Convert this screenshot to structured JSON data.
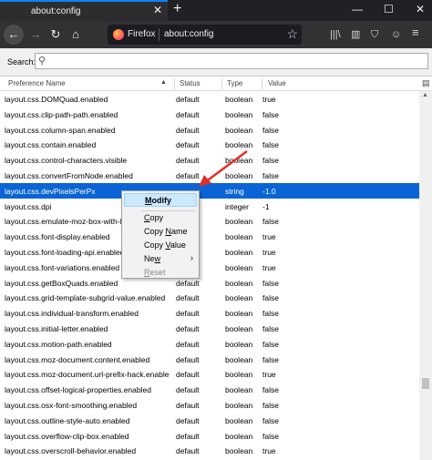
{
  "tab": {
    "title": "about:config",
    "close": "✕",
    "new_tab": "+"
  },
  "window_controls": {
    "minimize": "—",
    "maximize": "☐",
    "close": "✕"
  },
  "nav": {
    "back": "←",
    "forward": "→",
    "reload": "↻",
    "home": "⌂"
  },
  "urlbar": {
    "brand": "Firefox",
    "url": "about:config"
  },
  "toolbar": {
    "library": "|||\\",
    "sidebar": "▥",
    "shield": "⛉",
    "pocket": "☺",
    "menu": "≡"
  },
  "search": {
    "label": "Search:",
    "value": "",
    "glass": "⚲"
  },
  "columns": [
    "Preference Name",
    "Status",
    "Type",
    "Value"
  ],
  "rows": [
    {
      "name": "layout.css.DOMQuad.enabled",
      "status": "default",
      "type": "boolean",
      "value": "true"
    },
    {
      "name": "layout.css.clip-path-path.enabled",
      "status": "default",
      "type": "boolean",
      "value": "false"
    },
    {
      "name": "layout.css.column-span.enabled",
      "status": "default",
      "type": "boolean",
      "value": "false"
    },
    {
      "name": "layout.css.contain.enabled",
      "status": "default",
      "type": "boolean",
      "value": "false"
    },
    {
      "name": "layout.css.control-characters.visible",
      "status": "default",
      "type": "boolean",
      "value": "false"
    },
    {
      "name": "layout.css.convertFromNode.enabled",
      "status": "default",
      "type": "boolean",
      "value": "false"
    },
    {
      "name": "layout.css.devPixelsPerPx",
      "status": "",
      "type": "string",
      "value": "-1.0",
      "selected": true
    },
    {
      "name": "layout.css.dpi",
      "status": "",
      "type": "integer",
      "value": "-1"
    },
    {
      "name": "layout.css.emulate-moz-box-with-f",
      "status": "",
      "type": "boolean",
      "value": "false"
    },
    {
      "name": "layout.css.font-display.enabled",
      "status": "",
      "type": "boolean",
      "value": "true"
    },
    {
      "name": "layout.css.font-loading-api.enabled",
      "status": "",
      "type": "boolean",
      "value": "true"
    },
    {
      "name": "layout.css.font-variations.enabled",
      "status": "",
      "type": "boolean",
      "value": "true"
    },
    {
      "name": "layout.css.getBoxQuads.enabled",
      "status": "default",
      "type": "boolean",
      "value": "false"
    },
    {
      "name": "layout.css.grid-template-subgrid-value.enabled",
      "status": "default",
      "type": "boolean",
      "value": "false"
    },
    {
      "name": "layout.css.individual-transform.enabled",
      "status": "default",
      "type": "boolean",
      "value": "false"
    },
    {
      "name": "layout.css.initial-letter.enabled",
      "status": "default",
      "type": "boolean",
      "value": "false"
    },
    {
      "name": "layout.css.motion-path.enabled",
      "status": "default",
      "type": "boolean",
      "value": "false"
    },
    {
      "name": "layout.css.moz-document.content.enabled",
      "status": "default",
      "type": "boolean",
      "value": "false"
    },
    {
      "name": "layout.css.moz-document.url-prefix-hack.enabled",
      "status": "default",
      "type": "boolean",
      "value": "true"
    },
    {
      "name": "layout.css.offset-logical-properties.enabled",
      "status": "default",
      "type": "boolean",
      "value": "false"
    },
    {
      "name": "layout.css.osx-font-smoothing.enabled",
      "status": "default",
      "type": "boolean",
      "value": "false"
    },
    {
      "name": "layout.css.outline-style-auto.enabled",
      "status": "default",
      "type": "boolean",
      "value": "false"
    },
    {
      "name": "layout.css.overflow-clip-box.enabled",
      "status": "default",
      "type": "boolean",
      "value": "false"
    },
    {
      "name": "layout.css.overscroll-behavior.enabled",
      "status": "default",
      "type": "boolean",
      "value": "true"
    }
  ],
  "context_menu": {
    "items": [
      {
        "label": "Modify",
        "accel": "M",
        "highlighted": true
      },
      {
        "label": "Copy",
        "accel": "C"
      },
      {
        "label": "Copy Name",
        "accel": "N"
      },
      {
        "label": "Copy Value",
        "accel": "V"
      },
      {
        "label": "New",
        "accel": "w",
        "submenu": "›"
      },
      {
        "label": "Reset",
        "accel": "R",
        "disabled": true
      }
    ]
  },
  "colors": {
    "selection": "#0a64d6",
    "accent": "#0a84ff",
    "annotation_arrow": "#e0302a"
  }
}
